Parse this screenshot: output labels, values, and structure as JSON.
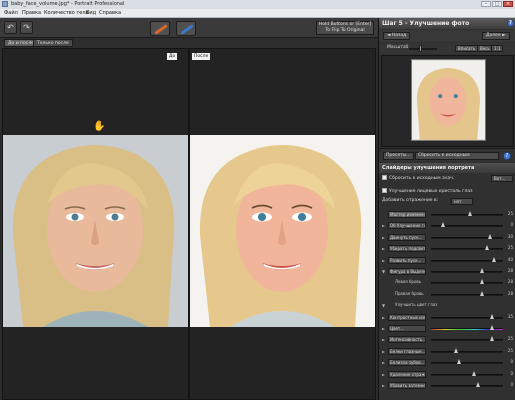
{
  "window": {
    "title": "baby_face_volume.jpg* - Portrait Professional",
    "min": "–",
    "max": "□",
    "close": "×"
  },
  "menu": [
    "Файл",
    "Правка",
    "Количество тела",
    "Вид",
    "Справка"
  ],
  "toolbar": {
    "undo_icon": "undo-icon",
    "redo_icon": "redo-icon",
    "tip_line1": "Hold Buttons or [Enter]",
    "tip_line2": "To Flip To Original"
  },
  "view_tabs": [
    "До и после",
    "Только после"
  ],
  "panes": {
    "before_label": "До",
    "after_label": "После"
  },
  "right": {
    "step_title": "Шаг 5 - Улучшение фото",
    "prev_label": "◄ Назад",
    "next_label": "Далее ►",
    "zoom_label": "Масштаб",
    "zoom_buttons": [
      "Вписать",
      "Весь",
      "1:1"
    ],
    "preset_btn": "Пресеты...",
    "preset_value": "Сбросить к исходным",
    "sliders_title": "Слайдеры улучшения портрета",
    "reset_label": "Сбросить к исходным знач.",
    "reset_btn": "Вот...",
    "auto_face_label": "Улучшение лицевых кристаль глаз",
    "texture_label": "Добавить отражение в:",
    "texture_value": "нет",
    "rows": [
      {
        "label": "Мастер изменения",
        "value": "25",
        "pos": 0.55,
        "expander": "",
        "boxed": true
      },
      {
        "label": "Об Улучшение глаз...",
        "value": "0",
        "pos": 0.18,
        "expander": "►",
        "boxed": true
      },
      {
        "label": "Двинуть пуск...",
        "value": "30",
        "pos": 0.82,
        "expander": "►",
        "boxed": true
      },
      {
        "label": "Убирать подсветку...",
        "value": "25",
        "pos": 0.78,
        "expander": "►",
        "boxed": true
      },
      {
        "label": "Развить пуск...",
        "value": "40",
        "pos": 0.88,
        "expander": "►",
        "boxed": true
      },
      {
        "label": "Фигура в Выделение...",
        "value": "28",
        "pos": 0.72,
        "expander": "▼",
        "boxed": true
      },
      {
        "label": "Левая бровь",
        "value": "28",
        "pos": 0.72,
        "expander": "",
        "boxed": false
      },
      {
        "label": "Правая бровь",
        "value": "28",
        "pos": 0.72,
        "expander": "",
        "boxed": false
      },
      {
        "label": "Улучшить цвет глаз",
        "value": "",
        "pos": -1,
        "expander": "▼",
        "boxed": false
      },
      {
        "label": "Контрастные изменения...",
        "value": "35",
        "pos": 0.86,
        "expander": "►",
        "boxed": true
      },
      {
        "label": "Цвет...",
        "value": "",
        "pos": 0.86,
        "expander": "►",
        "boxed": true,
        "rainbow": true
      },
      {
        "label": "Интенсивность...",
        "value": "25",
        "pos": 0.86,
        "expander": "►",
        "boxed": true
      },
      {
        "label": "Белки глазные...",
        "value": "25",
        "pos": 0.36,
        "expander": "►",
        "boxed": true
      },
      {
        "label": "Белизна зубов...",
        "value": "0",
        "pos": 0.4,
        "expander": "►",
        "boxed": true
      },
      {
        "label": "Удаление отражения в оправах...",
        "value": "0",
        "pos": 0.6,
        "expander": "►",
        "boxed": true
      },
      {
        "label": "Убавить затемнения кругов...",
        "value": "0",
        "pos": 0.66,
        "expander": "►",
        "boxed": true
      }
    ]
  },
  "colors": {
    "accent": "#4a7bd4",
    "panel": "#303030",
    "brush_orange": "#d86a2a",
    "brush_blue": "#3a78c8"
  }
}
